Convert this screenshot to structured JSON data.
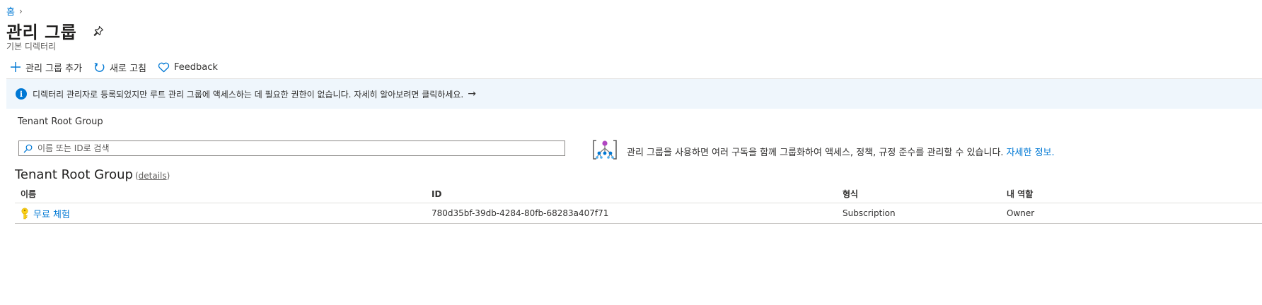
{
  "breadcrumb": {
    "home": "홈",
    "separator": "›"
  },
  "header": {
    "title": "관리 그룹",
    "subtitle": "기본 디렉터리",
    "pin_icon": "pin-icon"
  },
  "toolbar": {
    "add_label": "관리 그룹 추가",
    "refresh_label": "새로 고침",
    "feedback_label": "Feedback"
  },
  "info_bar": {
    "message": "디렉터리 관리자로 등록되었지만 루트 관리 그룹에 액세스하는 데 필요한 권한이 없습니다. 자세히 알아보려면 클릭하세요.",
    "arrow": "→"
  },
  "scope_label": "Tenant Root Group",
  "search": {
    "placeholder": "이름 또는 ID로 검색"
  },
  "mg_info": {
    "text": "관리 그룹을 사용하면 여러 구독을 함께 그룹화하여 액세스, 정책, 규정 준수를 관리할 수 있습니다.",
    "link": "자세한 정보."
  },
  "group": {
    "title": "Tenant Root Group",
    "details_open": "(",
    "details_link": "details",
    "details_close": ")"
  },
  "table": {
    "columns": [
      "이름",
      "ID",
      "형식",
      "내 역할"
    ],
    "rows": [
      {
        "name": "무료 체험",
        "id": "780d35bf-39db-4284-80fb-68283a407f71",
        "type": "Subscription",
        "role": "Owner"
      }
    ]
  },
  "colors": {
    "accent": "#0078d4",
    "info_bg": "#eff6fc",
    "key_icon": "#fcd116"
  }
}
